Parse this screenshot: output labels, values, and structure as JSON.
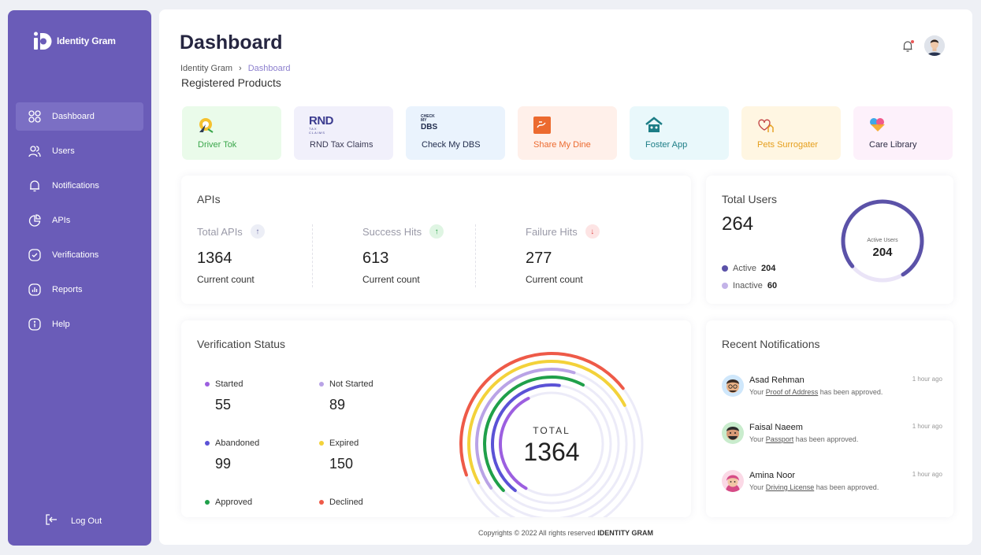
{
  "brand": {
    "name": "Identity Gram"
  },
  "sidebar": {
    "items": [
      {
        "label": "Dashboard",
        "icon": "grid-icon",
        "active": true
      },
      {
        "label": "Users",
        "icon": "users-icon"
      },
      {
        "label": "Notifications",
        "icon": "bell-icon"
      },
      {
        "label": "APIs",
        "icon": "pie-chart-icon"
      },
      {
        "label": "Verifications",
        "icon": "check-circle-icon"
      },
      {
        "label": "Reports",
        "icon": "bar-chart-icon"
      },
      {
        "label": "Help",
        "icon": "info-icon"
      }
    ],
    "logout": "Log Out"
  },
  "header": {
    "title": "Dashboard",
    "breadcrumb": [
      "Identity Gram",
      "Dashboard"
    ],
    "section": "Registered Products"
  },
  "products": [
    {
      "label": "Driver Tok",
      "bg": "#eafbea",
      "color": "#3aa64b"
    },
    {
      "label": "RND Tax Claims",
      "bg": "#f1f0fb",
      "color": "#3a3a55"
    },
    {
      "label": "Check My DBS",
      "bg": "#eaf3fd",
      "color": "#1f2a4a"
    },
    {
      "label": "Share My Dine",
      "bg": "#fff0ea",
      "color": "#ec6a2f"
    },
    {
      "label": "Foster App",
      "bg": "#e9f8fb",
      "color": "#1c7d86"
    },
    {
      "label": "Pets Surrogater",
      "bg": "#fff6e2",
      "color": "#e59e1b"
    },
    {
      "label": "Care Library",
      "bg": "#fdf1fb",
      "color": "#2c2c44"
    }
  ],
  "product_logo_text": {
    "rnd": "RND",
    "rnd_sub": "TAX CLAIMS",
    "dbs_top": "CHECK MY",
    "dbs": "DBS"
  },
  "apis": {
    "title": "APIs",
    "stats": [
      {
        "label": "Total APIs",
        "value": "1364",
        "sub": "Current count",
        "arrow": "↑",
        "badge_bg": "#eceef6",
        "badge_color": "#6a6aa0"
      },
      {
        "label": "Success Hits",
        "value": "613",
        "sub": "Current count",
        "arrow": "↑",
        "badge_bg": "#dff5e3",
        "badge_color": "#2aa24a"
      },
      {
        "label": "Failure Hits",
        "value": "277",
        "sub": "Current count",
        "arrow": "↓",
        "badge_bg": "#fde4e4",
        "badge_color": "#e04848"
      }
    ]
  },
  "users": {
    "title": "Total Users",
    "total": "264",
    "active_label": "Active",
    "active_value": "204",
    "inactive_label": "Inactive",
    "inactive_value": "60",
    "gauge_label": "Active Users",
    "gauge_value": "204",
    "active_fraction": 0.773,
    "colors": {
      "active": "#5b52a8",
      "inactive": "#c3b3e8"
    }
  },
  "verification": {
    "title": "Verification Status",
    "items": [
      {
        "label": "Started",
        "value": "55",
        "color": "#9c5fe0"
      },
      {
        "label": "Not Started",
        "value": "89",
        "color": "#b9a3e6"
      },
      {
        "label": "Abandoned",
        "value": "99",
        "color": "#5b52d6"
      },
      {
        "label": "Expired",
        "value": "150",
        "color": "#f3d23a"
      },
      {
        "label": "Approved",
        "value": "",
        "color": "#20a04a"
      },
      {
        "label": "Declined",
        "value": "",
        "color": "#ee5a48"
      }
    ],
    "total_label": "TOTAL",
    "total_value": "1364"
  },
  "notifications": {
    "title": "Recent Notifications",
    "items": [
      {
        "name": "Asad Rehman",
        "pre": "Your",
        "link": "Proof of Address",
        "post": "has been approved.",
        "time": "1 hour ago"
      },
      {
        "name": "Faisal Naeem",
        "pre": "Your",
        "link": "Passport",
        "post": "has been approved.",
        "time": "1 hour ago"
      },
      {
        "name": "Amina Noor",
        "pre": "Your",
        "link": "Driving License",
        "post": "has been approved.",
        "time": "1 hour ago"
      }
    ]
  },
  "footer": {
    "text": "Copyrights © 2022  All rights reserved",
    "brand": "IDENTITY GRAM"
  }
}
